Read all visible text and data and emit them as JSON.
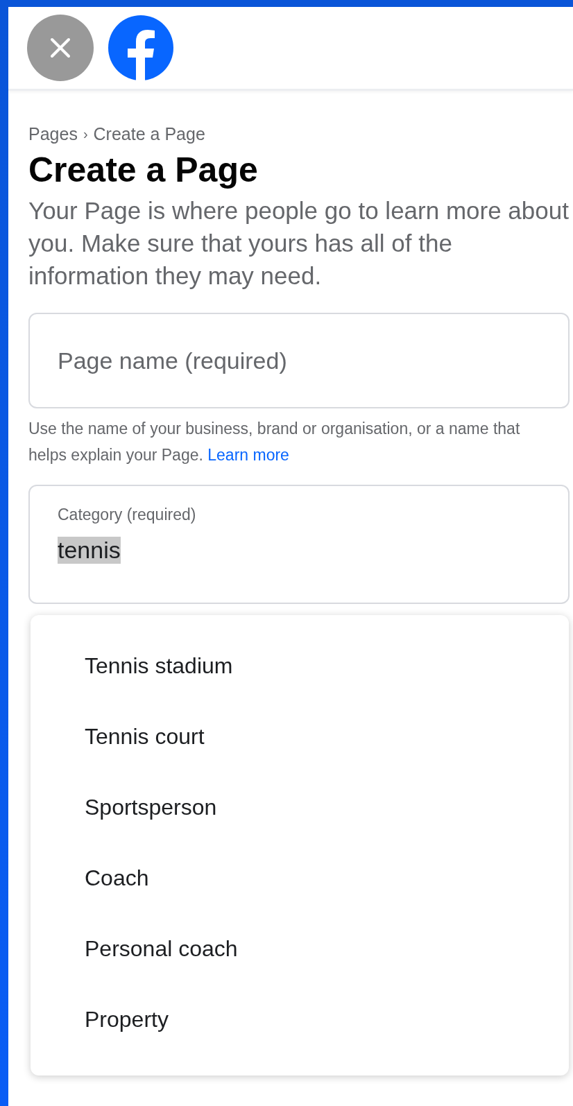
{
  "breadcrumb": {
    "parent": "Pages",
    "separator": "›",
    "current": "Create a Page"
  },
  "title": "Create a Page",
  "description": "Your Page is where people go to learn more about you. Make sure that yours has all of the information they may need.",
  "page_name_field": {
    "placeholder": "Page name (required)"
  },
  "helper": {
    "text": "Use the name of your business, brand or organisation, or a name that helps explain your Page.",
    "link": "Learn more"
  },
  "category_field": {
    "label": "Category (required)",
    "value": "tennis"
  },
  "suggestions": [
    {
      "label": "Tennis stadium"
    },
    {
      "label": "Tennis court"
    },
    {
      "label": "Sportsperson"
    },
    {
      "label": "Coach"
    },
    {
      "label": "Personal coach"
    },
    {
      "label": "Property"
    }
  ]
}
